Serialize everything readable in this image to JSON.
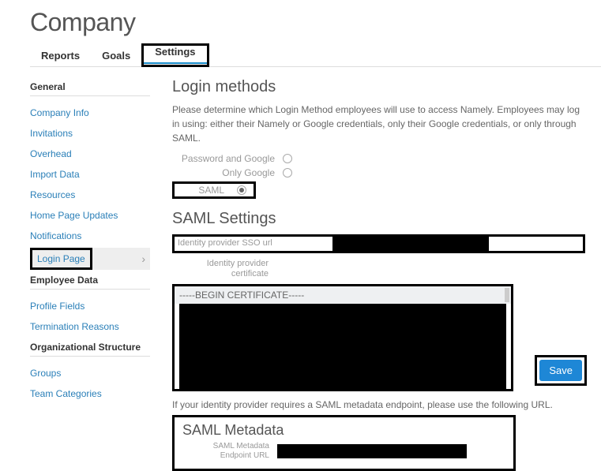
{
  "page_title": "Company",
  "tabs": {
    "reports": "Reports",
    "goals": "Goals",
    "settings": "Settings"
  },
  "sidebar": {
    "heading_general": "General",
    "items_general": [
      "Company Info",
      "Invitations",
      "Overhead",
      "Import Data",
      "Resources",
      "Home Page Updates",
      "Notifications",
      "Login Page"
    ],
    "heading_employee": "Employee Data",
    "items_employee": [
      "Profile Fields",
      "Termination Reasons"
    ],
    "heading_org": "Organizational Structure",
    "items_org": [
      "Groups",
      "Team Categories"
    ]
  },
  "main": {
    "login_methods_title": "Login methods",
    "login_methods_help": "Please determine which Login Method employees will use to access Namely. Employees may log in using: either their Namely or Google credentials, only their Google credentials, or only through SAML.",
    "radios": {
      "pw_google": "Password and Google",
      "only_google": "Only Google",
      "saml": "SAML"
    },
    "saml_settings_title": "SAML Settings",
    "sso_url_label": "Identity provider SSO url",
    "cert_label": "Identity provider certificate",
    "cert_begin": "-----BEGIN CERTIFICATE-----",
    "metadata_help": "If your identity provider requires a SAML metadata endpoint, please use the following URL.",
    "save_label": "Save",
    "metadata_title": "SAML Metadata",
    "metadata_endpoint_label": "SAML Metadata Endpoint URL"
  }
}
